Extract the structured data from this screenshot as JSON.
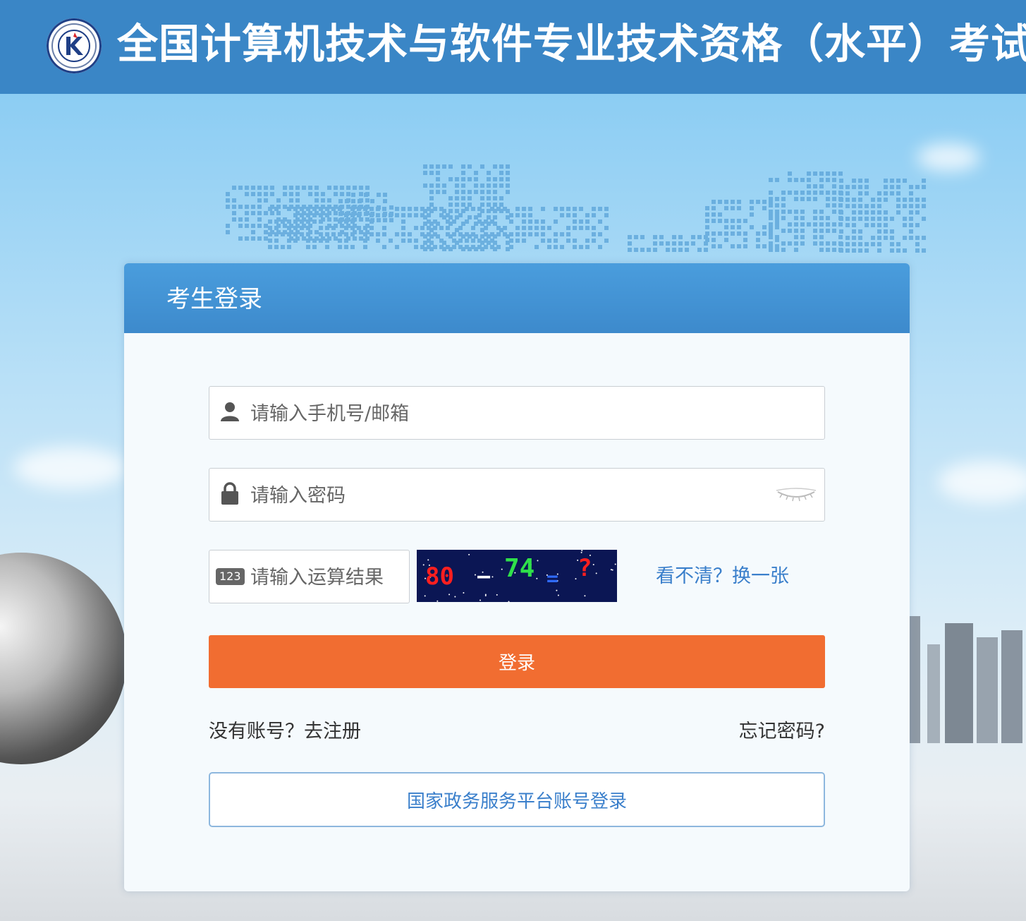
{
  "header": {
    "title": "全国计算机技术与软件专业技术资格（水平）考试"
  },
  "login": {
    "title": "考生登录",
    "username_placeholder": "请输入手机号/邮箱",
    "password_placeholder": "请输入密码",
    "captcha_placeholder": "请输入运算结果",
    "captcha_badge": "123",
    "captcha_parts": [
      "80",
      "—",
      "74",
      "=",
      "?"
    ],
    "refresh_label": "看不清？换一张",
    "submit_label": "登录",
    "register_label": "没有账号？去注册",
    "forgot_label": "忘记密码?",
    "gov_login_label": "国家政务服务平台账号登录"
  },
  "colors": {
    "header_blue": "#3a86c6",
    "accent_orange": "#f16d31",
    "link_blue": "#3a7fcb"
  }
}
